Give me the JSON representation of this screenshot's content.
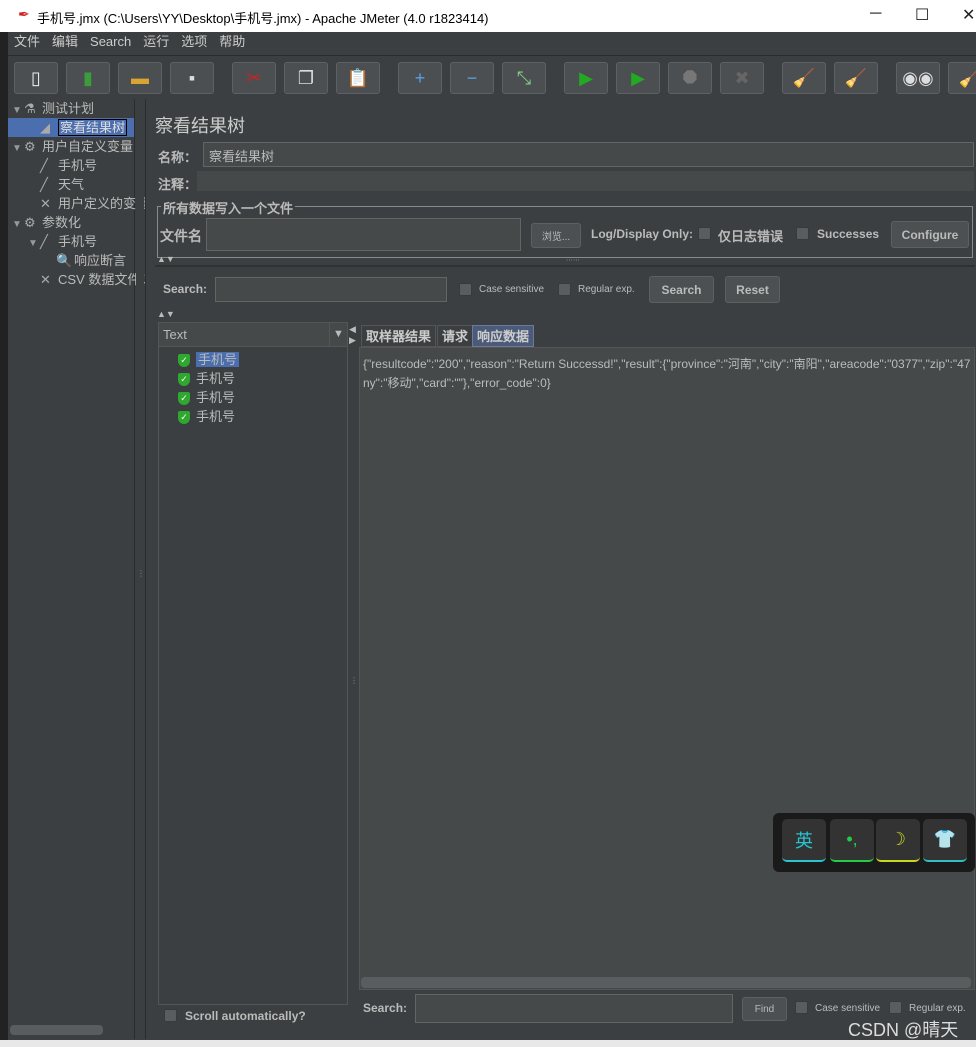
{
  "window": {
    "title": "手机号.jmx (C:\\Users\\YY\\Desktop\\手机号.jmx) - Apache JMeter (4.0 r1823414)",
    "minimize": "─",
    "maximize": "☐",
    "close": "✕"
  },
  "menu": [
    "文件",
    "编辑",
    "Search",
    "运行",
    "选项",
    "帮助"
  ],
  "toolbar": [
    {
      "icon": "new-icon",
      "glyph": "▯",
      "color": "#eeeeee"
    },
    {
      "icon": "templates-icon",
      "glyph": "▮",
      "color": "#3a9c3a"
    },
    {
      "icon": "open-icon",
      "glyph": "▬",
      "color": "#d9a530"
    },
    {
      "icon": "save-icon",
      "glyph": "▪",
      "color": "#dddddd"
    },
    {
      "icon": "cut-icon",
      "glyph": "✂",
      "color": "#cc2222"
    },
    {
      "icon": "copy-icon",
      "glyph": "❐",
      "color": "#dddddd"
    },
    {
      "icon": "paste-icon",
      "glyph": "📋",
      "color": "#c08a3a"
    },
    {
      "icon": "expand-icon",
      "glyph": "+",
      "color": "#5aa0e0"
    },
    {
      "icon": "collapse-icon",
      "glyph": "−",
      "color": "#5aa0e0"
    },
    {
      "icon": "toggle-icon",
      "glyph": "⤡",
      "color": "#88cc88"
    },
    {
      "icon": "start-icon",
      "glyph": "▶",
      "color": "#22aa22"
    },
    {
      "icon": "start-no-pause-icon",
      "glyph": "▶",
      "color": "#22aa22"
    },
    {
      "icon": "stop-icon",
      "glyph": "⯃",
      "color": "#777777"
    },
    {
      "icon": "shutdown-icon",
      "glyph": "✖",
      "color": "#666666"
    },
    {
      "icon": "clear-icon",
      "glyph": "🧹",
      "color": "#c8a060"
    },
    {
      "icon": "clear-all-icon",
      "glyph": "🧹",
      "color": "#c8a060"
    },
    {
      "icon": "search-icon",
      "glyph": "◉◉",
      "color": "#dddddd"
    },
    {
      "icon": "reset-search-icon",
      "glyph": "🧹",
      "color": "#e0b020"
    }
  ],
  "tree": [
    {
      "label": "测试计划",
      "level": 0,
      "toggle": "▼",
      "icon": "flask-icon",
      "glyph": "⚗"
    },
    {
      "label": "察看结果树",
      "level": 1,
      "toggle": "",
      "icon": "graph-icon",
      "glyph": "◢",
      "selected": true
    },
    {
      "label": "用户自定义变量",
      "level": 0,
      "toggle": "▼",
      "icon": "gear-icon",
      "glyph": "⚙"
    },
    {
      "label": "手机号",
      "level": 1,
      "toggle": "",
      "icon": "pipette-icon",
      "glyph": "╱"
    },
    {
      "label": "天气",
      "level": 1,
      "toggle": "",
      "icon": "pipette-icon",
      "glyph": "╱"
    },
    {
      "label": "用户定义的变量",
      "level": 1,
      "toggle": "",
      "icon": "tools-icon",
      "glyph": "✕"
    },
    {
      "label": "参数化",
      "level": 0,
      "toggle": "▼",
      "icon": "gear-icon",
      "glyph": "⚙"
    },
    {
      "label": "手机号",
      "level": 1,
      "toggle": "▼",
      "icon": "pipette-icon",
      "glyph": "╱"
    },
    {
      "label": "响应断言",
      "level": 2,
      "toggle": "",
      "icon": "magnifier-icon",
      "glyph": "🔍"
    },
    {
      "label": "CSV 数据文件设置",
      "level": 1,
      "toggle": "",
      "icon": "tools-icon",
      "glyph": "✕"
    }
  ],
  "panel": {
    "title": "察看结果树",
    "name_label": "名称：",
    "name_value": "察看结果树",
    "comment_label": "注释：",
    "comment_value": "",
    "fieldset_legend": "所有数据写入一个文件",
    "filename_label": "文件名",
    "filename_value": "",
    "browse": "浏览...",
    "log_display": "Log/Display Only:",
    "errors_only": "仅日志错误",
    "successes": "Successes",
    "configure": "Configure",
    "collapse_arrows": "▲▼",
    "grip": "⋯⋯"
  },
  "search": {
    "label": "Search:",
    "value": "",
    "case_sensitive": "Case sensitive",
    "regex": "Regular exp.",
    "search_btn": "Search",
    "reset_btn": "Reset"
  },
  "results": {
    "renderer": "Text",
    "dropdown": "▼",
    "items": [
      "手机号",
      "手机号",
      "手机号",
      "手机号"
    ],
    "scroll_auto": "Scroll automatically?"
  },
  "tabs": [
    "取样器结果",
    "请求",
    "响应数据"
  ],
  "active_tab": 2,
  "response": {
    "line1": "{\"resultcode\":\"200\",\"reason\":\"Return Successd!\",\"result\":{\"province\":\"河南\",\"city\":\"南阳\",\"areacode\":\"0377\",\"zip\":\"47",
    "line2": "ny\":\"移动\",\"card\":\"\"},\"error_code\":0}"
  },
  "find": {
    "label": "Search:",
    "value": "",
    "find_btn": "Find",
    "case_sensitive": "Case sensitive",
    "regex": "Regular exp."
  },
  "ime": [
    {
      "icon": "english-mode-icon",
      "glyph": "英",
      "color": "#2ac3d0"
    },
    {
      "icon": "punctuation-icon",
      "glyph": "•,",
      "color": "#22cc44"
    },
    {
      "icon": "moon-icon",
      "glyph": "☽",
      "color": "#c8d820"
    },
    {
      "icon": "skin-icon",
      "glyph": "👕",
      "color": "#30c0c0"
    }
  ],
  "watermark": "CSDN @晴天"
}
